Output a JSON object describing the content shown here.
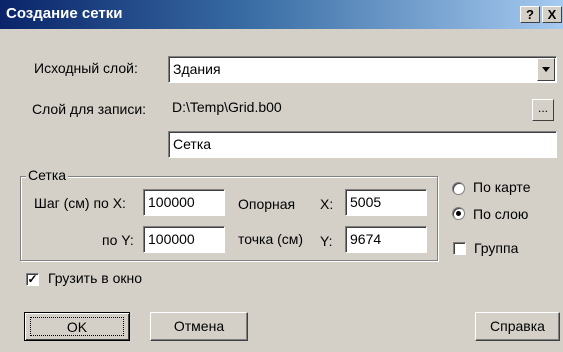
{
  "window": {
    "title": "Создание сетки",
    "help_label": "?",
    "close_label": "X"
  },
  "source_layer": {
    "label": "Исходный слой:",
    "value": "Здания"
  },
  "output_layer": {
    "label": "Слой для записи:",
    "path": "D:\\Temp\\Grid.b00",
    "browse_label": "...",
    "name": "Сетка"
  },
  "grid_group": {
    "title": "Сетка",
    "step_label": "Шаг (см) по X:",
    "step_x": "100000",
    "step_y_label": "по Y:",
    "step_y": "100000",
    "ref_point_label_1": "Опорная",
    "ref_point_label_2": "точка (см)",
    "x_label": "X:",
    "ref_x": "5005",
    "y_label": "Y:",
    "ref_y": "9674"
  },
  "options": {
    "by_map_label": "По карте",
    "by_map_checked": false,
    "by_layer_label": "По слою",
    "by_layer_checked": true,
    "group_label": "Группа",
    "group_checked": false,
    "load_window_label": "Грузить в окно",
    "load_window_checked": true
  },
  "buttons": {
    "ok": "OK",
    "cancel": "Отмена",
    "help": "Справка"
  }
}
